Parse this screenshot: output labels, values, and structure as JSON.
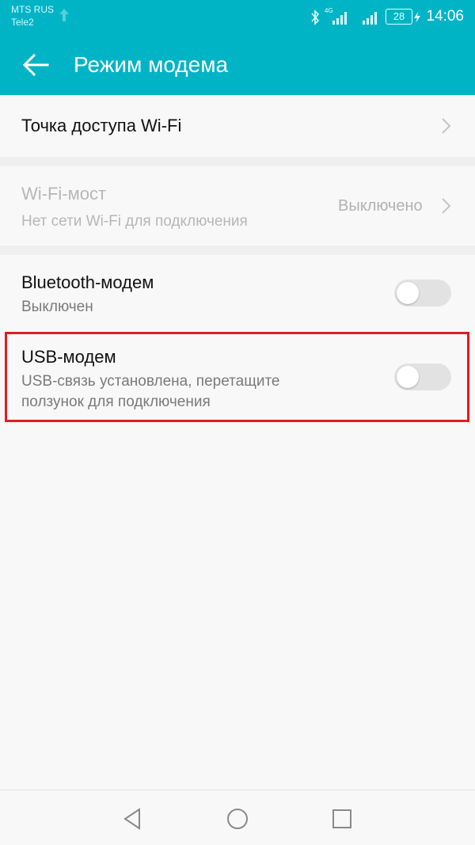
{
  "status_bar": {
    "carrier_1": "MTS RUS",
    "carrier_2": "Tele2",
    "network_badge": "4G",
    "battery": "28",
    "time": "14:06"
  },
  "app_bar": {
    "title": "Режим модема"
  },
  "items": [
    {
      "title": "Точка доступа Wi-Fi"
    },
    {
      "title": "Wi-Fi-мост",
      "subtitle": "Нет сети Wi-Fi для подключения",
      "value": "Выключено"
    },
    {
      "title": "Bluetooth-модем",
      "subtitle": "Выключен",
      "toggle_on": false
    },
    {
      "title": "USB-модем",
      "subtitle_line1": "USB-связь установлена, перетащите",
      "subtitle_line2": "ползунок для подключения",
      "toggle_on": false
    }
  ],
  "colors": {
    "accent": "#00b4c6",
    "highlight": "#e31b23"
  },
  "icons": {
    "back": "arrow-left-icon",
    "chevron": "chevron-right-icon",
    "nav_back": "triangle-back-icon",
    "nav_home": "circle-home-icon",
    "nav_recents": "square-recents-icon"
  }
}
